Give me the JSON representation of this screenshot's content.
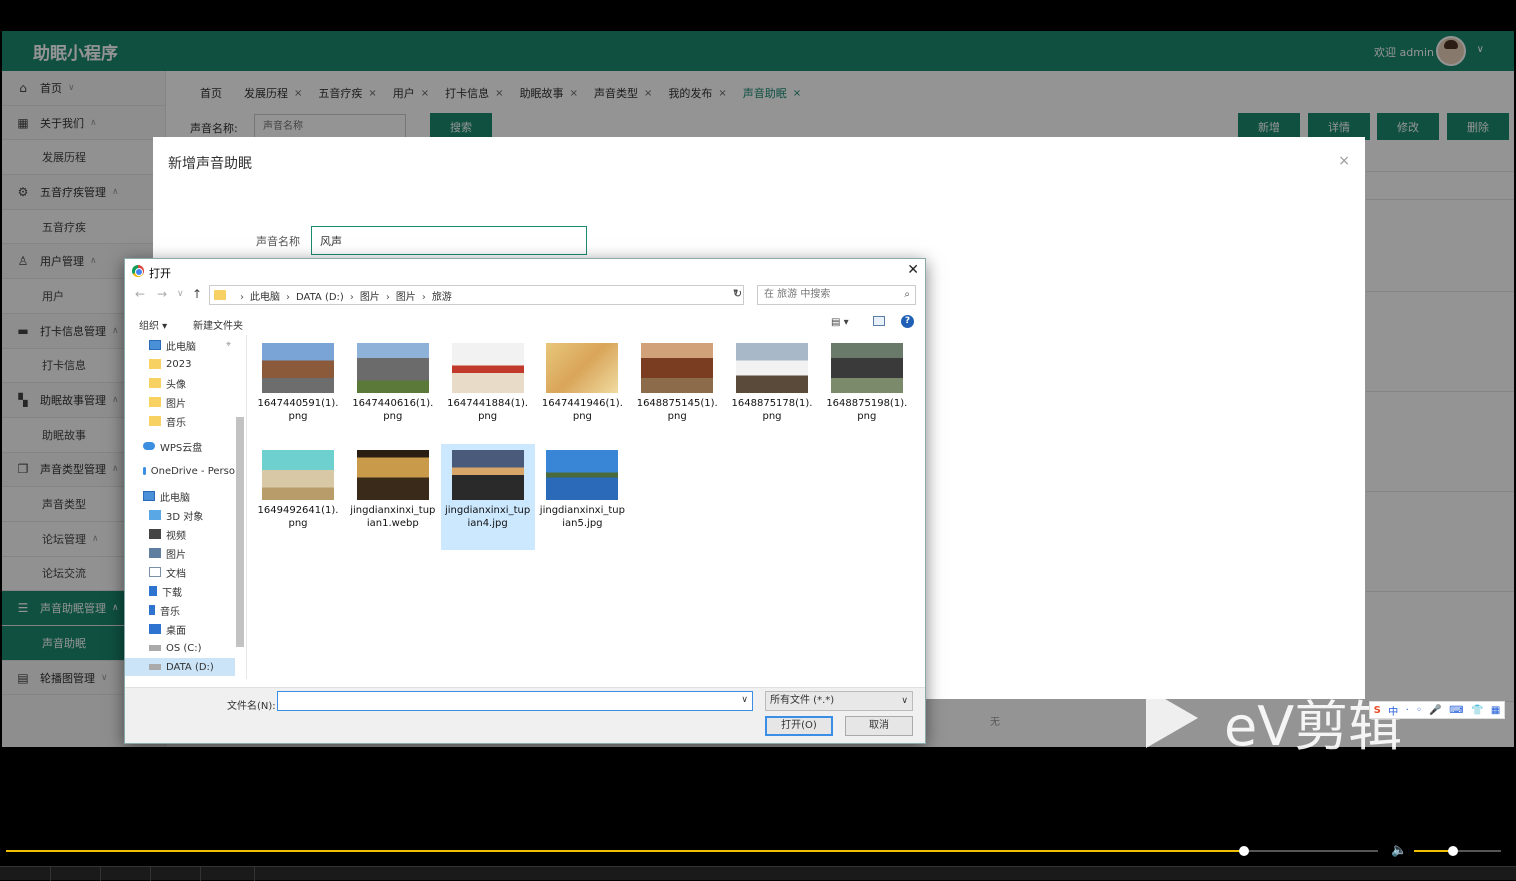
{
  "app": {
    "title": "助眠小程序",
    "welcome": "欢迎 admin",
    "accent": "#1a8a70"
  },
  "sidebar": {
    "items": [
      {
        "label": "首页",
        "icon": "home-icon",
        "type": "top"
      },
      {
        "label": "关于我们",
        "icon": "grid-icon",
        "type": "top"
      },
      {
        "label": "发展历程",
        "type": "sub"
      },
      {
        "label": "五音疗疾管理",
        "icon": "gear-icon",
        "type": "top"
      },
      {
        "label": "五音疗疾",
        "type": "sub"
      },
      {
        "label": "用户管理",
        "icon": "user-icon",
        "type": "top"
      },
      {
        "label": "用户",
        "type": "sub"
      },
      {
        "label": "打卡信息管理",
        "icon": "card-icon",
        "type": "top"
      },
      {
        "label": "打卡信息",
        "type": "sub"
      },
      {
        "label": "助眠故事管理",
        "icon": "apps-icon",
        "type": "top"
      },
      {
        "label": "助眠故事",
        "type": "sub"
      },
      {
        "label": "声音类型管理",
        "icon": "copy-icon",
        "type": "top"
      },
      {
        "label": "声音类型",
        "type": "sub"
      },
      {
        "label": "论坛管理",
        "type": "sub-head"
      },
      {
        "label": "论坛交流",
        "type": "sub"
      },
      {
        "label": "声音助眠管理",
        "icon": "db-icon",
        "type": "active"
      },
      {
        "label": "声音助眠",
        "type": "subactive"
      },
      {
        "label": "轮播图管理",
        "icon": "slides-icon",
        "type": "top"
      }
    ]
  },
  "tabs": [
    {
      "label": "首页",
      "close": ""
    },
    {
      "label": "发展历程",
      "close": "×"
    },
    {
      "label": "五音疗疾",
      "close": "×"
    },
    {
      "label": "用户",
      "close": "×"
    },
    {
      "label": "打卡信息",
      "close": "×"
    },
    {
      "label": "助眠故事",
      "close": "×"
    },
    {
      "label": "声音类型",
      "close": "×"
    },
    {
      "label": "我的发布",
      "close": "×"
    },
    {
      "label": "声音助眠",
      "close": "×"
    }
  ],
  "search": {
    "label": "声音名称:",
    "placeholder": "声音名称",
    "button": "搜索"
  },
  "actions": {
    "add": "新增",
    "detail": "详情",
    "edit": "修改",
    "delete": "删除"
  },
  "table": {
    "empty_cell": "无"
  },
  "modal": {
    "title": "新增声音助眠",
    "close": "×",
    "field_label": "声音名称",
    "field_value": "风声"
  },
  "dialog": {
    "title": "打开",
    "close": "✕",
    "breadcrumb": [
      "此电脑",
      "DATA (D:)",
      "图片",
      "图片",
      "旅游"
    ],
    "search_placeholder": "在 旅游 中搜索",
    "organize": "组织 ▾",
    "new_folder": "新建文件夹",
    "help": "?",
    "nav_items": [
      {
        "label": "此电脑",
        "icon": "ic-pc",
        "indent": 24,
        "pin": true
      },
      {
        "label": "2023",
        "icon": "ic-folder",
        "indent": 24
      },
      {
        "label": "头像",
        "icon": "ic-folder",
        "indent": 24
      },
      {
        "label": "图片",
        "icon": "ic-folder",
        "indent": 24
      },
      {
        "label": "音乐",
        "icon": "ic-folder",
        "indent": 24
      },
      {
        "label": "WPS云盘",
        "icon": "ic-cloud",
        "indent": 18
      },
      {
        "label": "OneDrive - Perso",
        "icon": "ic-cloud",
        "indent": 18
      },
      {
        "label": "此电脑",
        "icon": "ic-pc",
        "indent": 18
      },
      {
        "label": "3D 对象",
        "icon": "ic-3d",
        "indent": 24
      },
      {
        "label": "视频",
        "icon": "ic-video",
        "indent": 24
      },
      {
        "label": "图片",
        "icon": "ic-img",
        "indent": 24
      },
      {
        "label": "文档",
        "icon": "ic-doc",
        "indent": 24
      },
      {
        "label": "下载",
        "icon": "ic-dl",
        "indent": 24
      },
      {
        "label": "音乐",
        "icon": "ic-music",
        "indent": 24
      },
      {
        "label": "桌面",
        "icon": "ic-desk",
        "indent": 24
      },
      {
        "label": "OS (C:)",
        "icon": "ic-drive",
        "indent": 24
      },
      {
        "label": "DATA (D:)",
        "icon": "ic-drive",
        "indent": 24,
        "selected": true
      }
    ],
    "files": [
      {
        "name": "1647440591(1).png",
        "thumb": "temple"
      },
      {
        "name": "1647440616(1).png",
        "thumb": "rock"
      },
      {
        "name": "1647441884(1).png",
        "thumb": "banner"
      },
      {
        "name": "1647441946(1).png",
        "thumb": "map"
      },
      {
        "name": "1648875145(1).png",
        "thumb": "courtyard"
      },
      {
        "name": "1648875178(1).png",
        "thumb": "villa"
      },
      {
        "name": "1648875198(1).png",
        "thumb": "house"
      },
      {
        "name": "1649492641(1).png",
        "thumb": "table"
      },
      {
        "name": "jingdianxinxi_tupian1.webp",
        "thumb": "sunset"
      },
      {
        "name": "jingdianxinxi_tupian4.jpg",
        "thumb": "lake",
        "selected": true
      },
      {
        "name": "jingdianxinxi_tupian5.jpg",
        "thumb": "bluelake"
      }
    ],
    "filename_label": "文件名(N):",
    "filename_value": "",
    "file_type": "所有文件 (*.*)",
    "open": "打开(O)",
    "cancel": "取消"
  },
  "watermark": {
    "text": "eV剪辑"
  },
  "ime": [
    "S",
    "中",
    "·",
    "◦",
    "🎤",
    "⌨",
    "👕",
    "▦"
  ]
}
